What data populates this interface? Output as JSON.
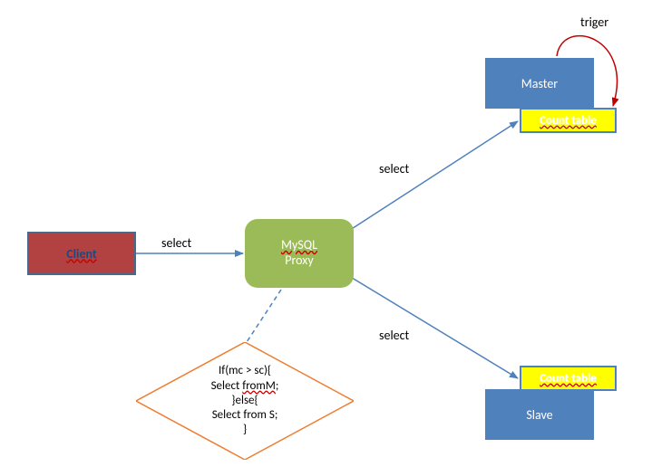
{
  "nodes": {
    "client": {
      "label": "Client"
    },
    "proxy": {
      "line1": "MySQL",
      "line2": "Proxy"
    },
    "master": {
      "label": "Master"
    },
    "slave": {
      "label": "Slave"
    },
    "count_table_top": {
      "label": "Count  table"
    },
    "count_table_bot": {
      "label": "Count  table"
    }
  },
  "edges": {
    "client_proxy": {
      "label": "select"
    },
    "proxy_master_ct": {
      "label": "select"
    },
    "proxy_slave_ct": {
      "label": "select"
    },
    "trigger": {
      "label": "triger"
    }
  },
  "decision": {
    "l1": "If(mc > sc){",
    "l2a": "Select ",
    "l2b": "fromM",
    "l2c": ";",
    "l3": "}else{",
    "l4": "Select from S;",
    "l5": "}"
  }
}
